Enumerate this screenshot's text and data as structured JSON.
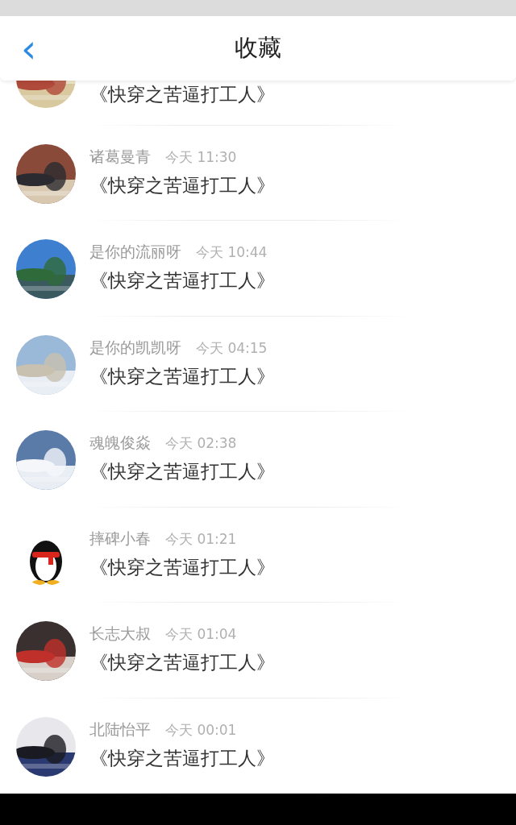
{
  "header": {
    "back_icon": "‹",
    "title": "收藏"
  },
  "items": [
    {
      "title": "《快穿之苦逼打工人》"
    },
    {
      "name": "诸葛曼青",
      "time": "今天 11:30",
      "title": "《快穿之苦逼打工人》"
    },
    {
      "name": "是你的流丽呀",
      "time": "今天 10:44",
      "title": "《快穿之苦逼打工人》"
    },
    {
      "name": "是你的凯凯呀",
      "time": "今天 04:15",
      "title": "《快穿之苦逼打工人》"
    },
    {
      "name": "魂魄俊焱",
      "time": "今天 02:38",
      "title": "《快穿之苦逼打工人》"
    },
    {
      "name": "摔碑小春",
      "time": "今天 01:21",
      "title": "《快穿之苦逼打工人》"
    },
    {
      "name": "长志大叔",
      "time": "今天 01:04",
      "title": "《快穿之苦逼打工人》"
    },
    {
      "name": "北陆怡平",
      "time": "今天 00:01",
      "title": "《快穿之苦逼打工人》"
    }
  ]
}
